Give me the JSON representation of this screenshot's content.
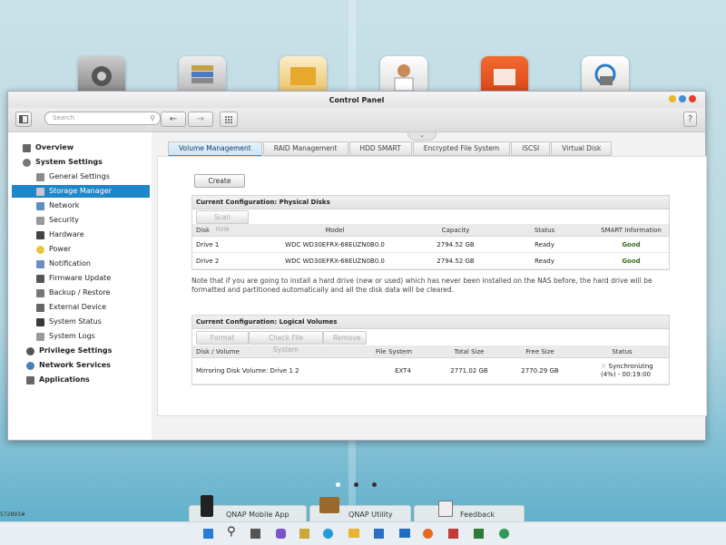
{
  "window": {
    "title": "Control Panel"
  },
  "toolbar": {
    "search_placeholder": "Search",
    "help": "?"
  },
  "sidebar": {
    "items": [
      {
        "label": "Overview",
        "icon": "grid-icon",
        "bold": true
      },
      {
        "label": "System Settings",
        "icon": "gear-icon",
        "bold": true
      },
      {
        "label": "General Settings",
        "icon": "sliders-icon"
      },
      {
        "label": "Storage Manager",
        "icon": "database-icon",
        "selected": true
      },
      {
        "label": "Network",
        "icon": "network-icon"
      },
      {
        "label": "Security",
        "icon": "lock-icon"
      },
      {
        "label": "Hardware",
        "icon": "hardware-icon"
      },
      {
        "label": "Power",
        "icon": "bulb-icon"
      },
      {
        "label": "Notification",
        "icon": "bell-icon"
      },
      {
        "label": "Firmware Update",
        "icon": "firmware-icon"
      },
      {
        "label": "Backup / Restore",
        "icon": "backup-icon"
      },
      {
        "label": "External Device",
        "icon": "usb-icon"
      },
      {
        "label": "System Status",
        "icon": "monitor-icon"
      },
      {
        "label": "System Logs",
        "icon": "log-icon"
      },
      {
        "label": "Privilege Settings",
        "icon": "user-icon",
        "bold": true
      },
      {
        "label": "Network Services",
        "icon": "globe-icon",
        "bold": true
      },
      {
        "label": "Applications",
        "icon": "apps-icon",
        "bold": true
      }
    ]
  },
  "tabs": [
    "Volume Management",
    "RAID Management",
    "HDD SMART",
    "Encrypted File System",
    "iSCSI",
    "Virtual Disk"
  ],
  "main": {
    "create_label": "Create",
    "physical": {
      "title": "Current Configuration: Physical Disks",
      "scan_label": "Scan now",
      "headers": [
        "Disk",
        "Model",
        "Capacity",
        "Status",
        "SMART Information"
      ],
      "rows": [
        [
          "Drive 1",
          "WDC WD30EFRX-68EUZN0B0.0",
          "2794.52 GB",
          "Ready",
          "Good"
        ],
        [
          "Drive 2",
          "WDC WD30EFRX-68EUZN0B0.0",
          "2794.52 GB",
          "Ready",
          "Good"
        ]
      ]
    },
    "note": "Note that if you are going to install a hard drive (new or used) which has never been installed on the NAS before, the hard drive will be formatted and partitioned automatically and all the disk data will be cleared.",
    "logical": {
      "title": "Current Configuration: Logical Volumes",
      "buttons": [
        "Format",
        "Check File System",
        "Remove"
      ],
      "headers": [
        "Disk / Volume",
        "File System",
        "Total Size",
        "Free Size",
        "Status"
      ],
      "row": {
        "volume": "Mirroring Disk Volume: Drive 1 2",
        "fs": "EXT4",
        "total": "2771.02 GB",
        "free": "2770.29 GB",
        "status_line1": "Synchronizing",
        "status_line2": "(4%) - 00:19:00"
      }
    }
  },
  "dock": {
    "items": [
      "QNAP Mobile App",
      "QNAP Utility",
      "Feedback"
    ]
  },
  "desktop": {
    "corner_text": "572893#"
  },
  "colors": {
    "accent": "#1f87c9",
    "good": "#3a6b1f"
  }
}
